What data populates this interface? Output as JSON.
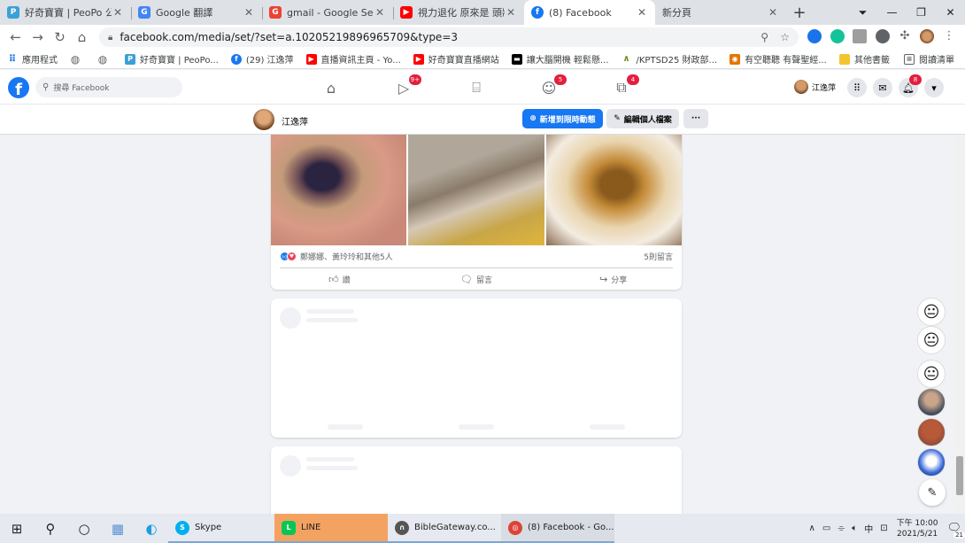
{
  "browser": {
    "tabs": [
      {
        "title": "好奇寶寶 | PeoPo 公民",
        "favicon": "P",
        "color": "#3aa0d8"
      },
      {
        "title": "Google 翻譯",
        "favicon": "G",
        "color": "#4285f4"
      },
      {
        "title": "gmail - Google Search",
        "favicon": "G",
        "color": "#ea4335"
      },
      {
        "title": "視力退化 原來是 頭狀",
        "favicon": "▶",
        "color": "#ff0000"
      },
      {
        "title": "(8) Facebook",
        "favicon": "f",
        "color": "#1877f2"
      },
      {
        "title": "新分頁",
        "favicon": "",
        "color": "#dee1e6"
      }
    ],
    "new_tab": "+",
    "url": "facebook.com/media/set/?set=a.10205219896965709&type=3",
    "bookmarks": [
      {
        "label": "應用程式",
        "icon": "⠿",
        "color": "#1a73e8"
      },
      {
        "label": "",
        "icon": "◍",
        "color": "#5f6368"
      },
      {
        "label": "",
        "icon": "◍",
        "color": "#5f6368"
      },
      {
        "label": "好奇寶寶 | PeoPo...",
        "icon": "P",
        "color": "#3aa0d8"
      },
      {
        "label": "(29) 江逸萍",
        "icon": "f",
        "color": "#1877f2"
      },
      {
        "label": "直播資訊主頁 - Yo...",
        "icon": "▶",
        "color": "#ff0000"
      },
      {
        "label": "好奇寶寶直播網站",
        "icon": "▶",
        "color": "#ff0000"
      },
      {
        "label": "讓大腦開機 輕鬆懸...",
        "icon": "▬",
        "color": "#000000"
      },
      {
        "label": "/KPTSD25 財政部...",
        "icon": "∧",
        "color": "#6b8e23"
      },
      {
        "label": "有空聽聽 有聲聖經...",
        "icon": "◉",
        "color": "#e37400"
      }
    ],
    "other_bookmarks": "其他書籤",
    "reading_list": "閱讀清單"
  },
  "facebook": {
    "search_placeholder": "搜尋 Facebook",
    "nav_badges": {
      "watch": "9+",
      "groups": "5",
      "gaming": "4",
      "notifications": "8"
    },
    "profile_name": "江逸萍",
    "subheader": {
      "name": "江逸萍",
      "add_story": "新增到限時動態",
      "edit_profile": "編輯個人檔案",
      "more": "···"
    },
    "post": {
      "reactions_text": "鄭娜娜、黃玲玲和其他5人",
      "comments_count": "5則留言",
      "like_label": "讚",
      "comment_label": "留言",
      "share_label": "分享"
    }
  },
  "taskbar": {
    "apps": [
      {
        "label": "Skype",
        "icon": "S",
        "color": "#00aff0"
      },
      {
        "label": "LINE",
        "icon": "L",
        "color": "#06c755"
      },
      {
        "label": "BibleGateway.co...",
        "icon": "∩",
        "color": "#555555"
      },
      {
        "label": "(8) Facebook - Go...",
        "icon": "◎",
        "color": "#db4437"
      }
    ],
    "ime": "中",
    "time": "下午 10:00",
    "date": "2021/5/21",
    "notification_count": "21"
  }
}
